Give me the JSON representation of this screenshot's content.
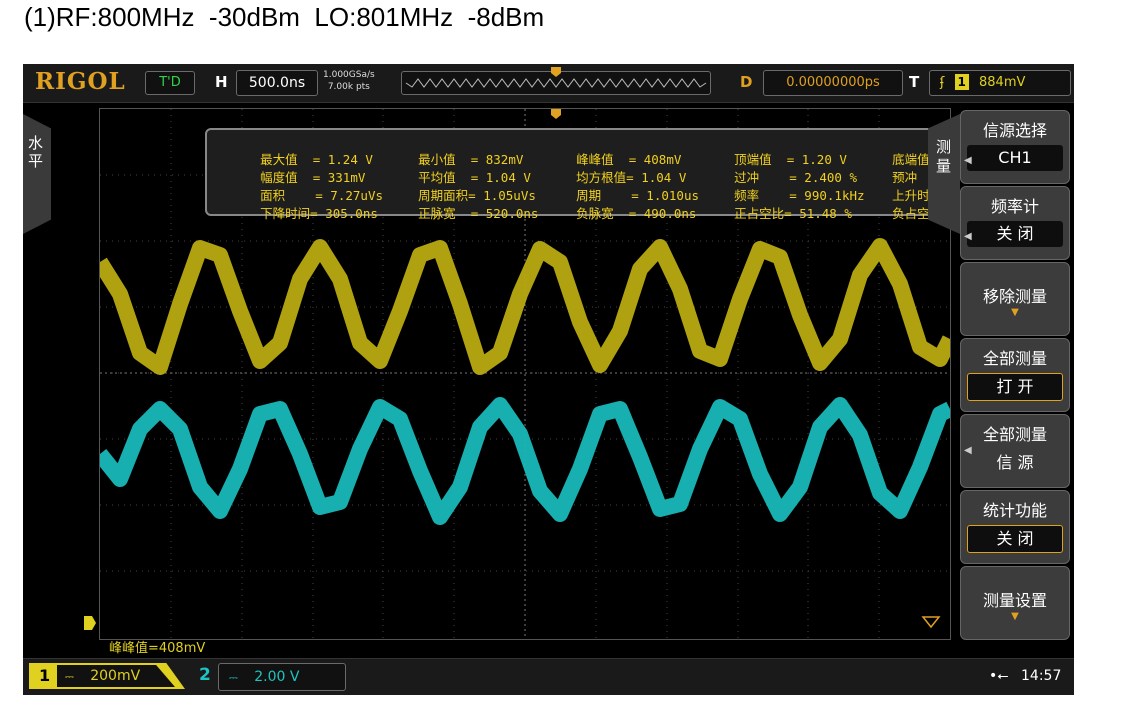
{
  "caption": "(1)RF:800MHz  -30dBm  LO:801MHz  -8dBm",
  "topbar": {
    "logo": "RIGOL",
    "mode": "T'D",
    "h_label": "H",
    "timebase": "500.0ns",
    "sample_rate": "1.000GSa/s",
    "mem_depth": "7.00k pts",
    "d_label": "D",
    "delay": "0.00000000ps",
    "t_label": "T",
    "trigger_ch": "1",
    "trigger_level": "884mV"
  },
  "left_tab": "水平",
  "right_tab": "测量",
  "measurements": [
    [
      "最大值  = 1.24 V",
      "最小值  = 832mV",
      "峰峰值  = 408mV",
      "顶端值  = 1.20 V",
      "底端值  ="
    ],
    [
      "幅度值  = 331mV",
      "平均值  = 1.04 V",
      "均方根值= 1.04 V",
      "过冲    = 2.400 %",
      "预冲    ="
    ],
    [
      "面积    = 7.27uVs",
      "周期面积= 1.05uVs",
      "周期    = 1.010us",
      "频率    = 990.1kHz",
      "上升时间="
    ],
    [
      "下降时间= 305.0ns",
      "正脉宽  = 520.0ns",
      "负脉宽  = 490.0ns",
      "正占空比= 51.48 %",
      "负占空比="
    ]
  ],
  "menu": {
    "source_title": "信源选择",
    "source_value": "CH1",
    "counter_title": "频率计",
    "counter_value": "关  闭",
    "remove_title": "移除测量",
    "all_title": "全部测量",
    "all_value": "打  开",
    "all_src_title": "全部测量",
    "all_src_value": "信  源",
    "stats_title": "统计功能",
    "stats_value": "关  闭",
    "settings_title": "测量设置"
  },
  "footer_measure": "峰峰值=408mV",
  "bottombar": {
    "ch1_num": "1",
    "ch1_scale": "200mV",
    "ch2_num": "2",
    "ch2_scale": "2.00 V",
    "clock": "14:57"
  },
  "colors": {
    "ch1": "#d4c40c",
    "ch2": "#1ec3c3",
    "accent": "#e0a020"
  }
}
